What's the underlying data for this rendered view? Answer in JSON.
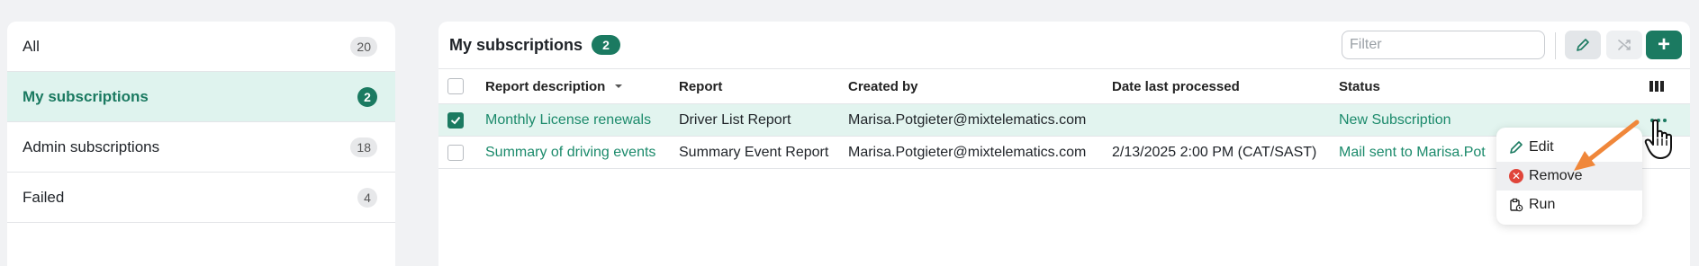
{
  "sidebar": {
    "items": [
      {
        "label": "All",
        "count": "20"
      },
      {
        "label": "My subscriptions",
        "count": "2"
      },
      {
        "label": "Admin subscriptions",
        "count": "18"
      },
      {
        "label": "Failed",
        "count": "4"
      }
    ]
  },
  "main": {
    "title": "My subscriptions",
    "count": "2",
    "filter_placeholder": "Filter",
    "toolbar": {
      "edit_icon": "pencil-icon",
      "shuffle_icon": "shuffle-icon",
      "add_label": "+"
    }
  },
  "table": {
    "headers": {
      "description": "Report description",
      "report": "Report",
      "created_by": "Created by",
      "date": "Date last processed",
      "status": "Status"
    },
    "rows": [
      {
        "description": "Monthly License renewals",
        "report": "Driver List Report",
        "created_by": "Marisa.Potgieter@mixtelematics.com",
        "date": "",
        "status": "New Subscription",
        "checked": true
      },
      {
        "description": "Summary of driving events",
        "report": "Summary Event Report",
        "created_by": "Marisa.Potgieter@mixtelematics.com",
        "date": "2/13/2025 2:00 PM (CAT/SAST)",
        "status": "Mail sent to Marisa.Pot",
        "checked": false
      }
    ]
  },
  "context_menu": {
    "items": [
      {
        "label": "Edit"
      },
      {
        "label": "Remove"
      },
      {
        "label": "Run"
      }
    ]
  },
  "colors": {
    "accent": "#1b7a61",
    "link": "#1b8a6b",
    "danger": "#e0453a",
    "arrow": "#f0873a"
  }
}
